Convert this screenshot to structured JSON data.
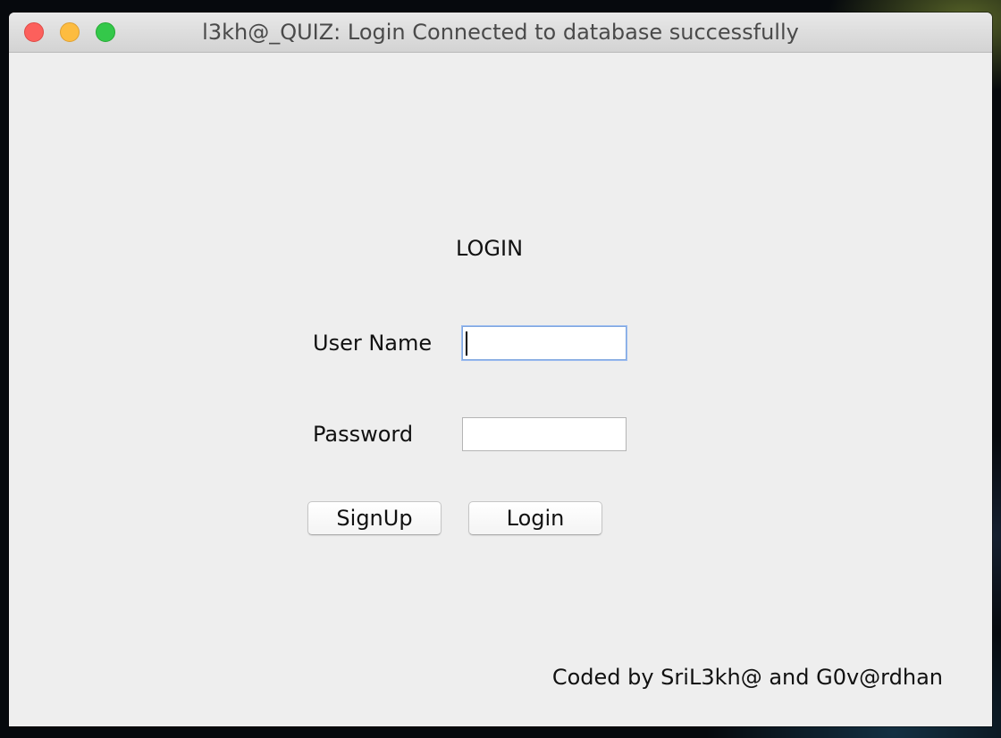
{
  "window": {
    "title": "l3kh@_QUIZ: Login Connected to database successfully",
    "controls": {
      "close_color": "#fc605c",
      "minimize_color": "#fdbc40",
      "maximize_color": "#34c84a"
    }
  },
  "form": {
    "heading": "LOGIN",
    "username": {
      "label": "User Name",
      "value": "",
      "focused": true
    },
    "password": {
      "label": "Password",
      "value": ""
    },
    "buttons": {
      "signup_label": "SignUp",
      "login_label": "Login"
    }
  },
  "footer": {
    "credit": "Coded by SriL3kh@ and G0v@rdhan"
  },
  "theme": {
    "focus_ring": "#7fa7e0",
    "panel_background": "#eeeeee"
  }
}
